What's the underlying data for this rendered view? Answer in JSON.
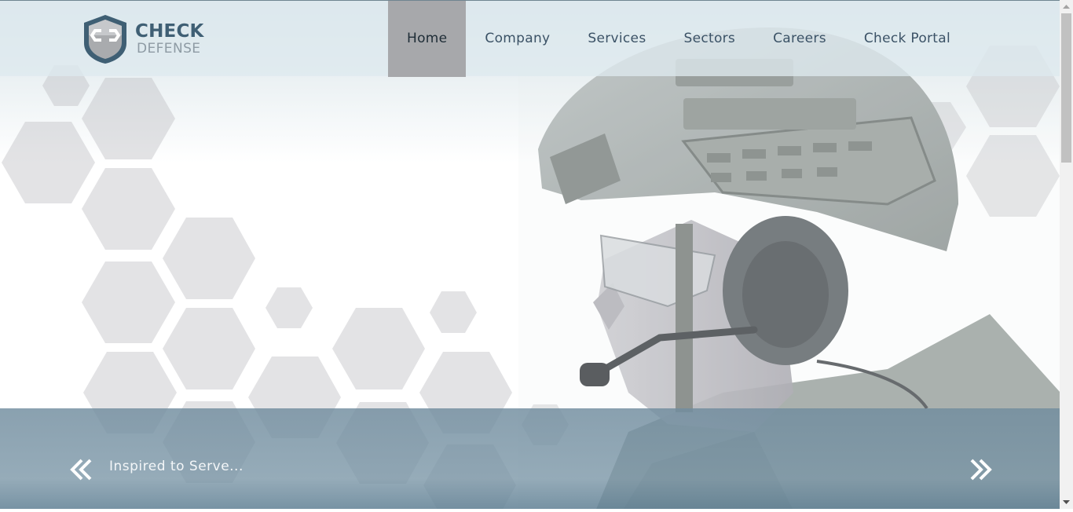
{
  "brand": {
    "name_line1": "CHECK",
    "name_line2": "DEFENSE"
  },
  "nav": {
    "items": [
      {
        "label": "Home",
        "active": true
      },
      {
        "label": "Company",
        "active": false
      },
      {
        "label": "Services",
        "active": false
      },
      {
        "label": "Sectors",
        "active": false
      },
      {
        "label": "Careers",
        "active": false
      },
      {
        "label": "Check Portal",
        "active": false
      }
    ]
  },
  "hero": {
    "caption": "Inspired to Serve...",
    "prev_icon": "double-chevron-left-icon",
    "next_icon": "double-chevron-right-icon"
  },
  "colors": {
    "brand_blue": "#3f5f74",
    "nav_active_bg": "#a7a8ab",
    "band": "#708c9e",
    "hexagon": "#d9d9db"
  }
}
